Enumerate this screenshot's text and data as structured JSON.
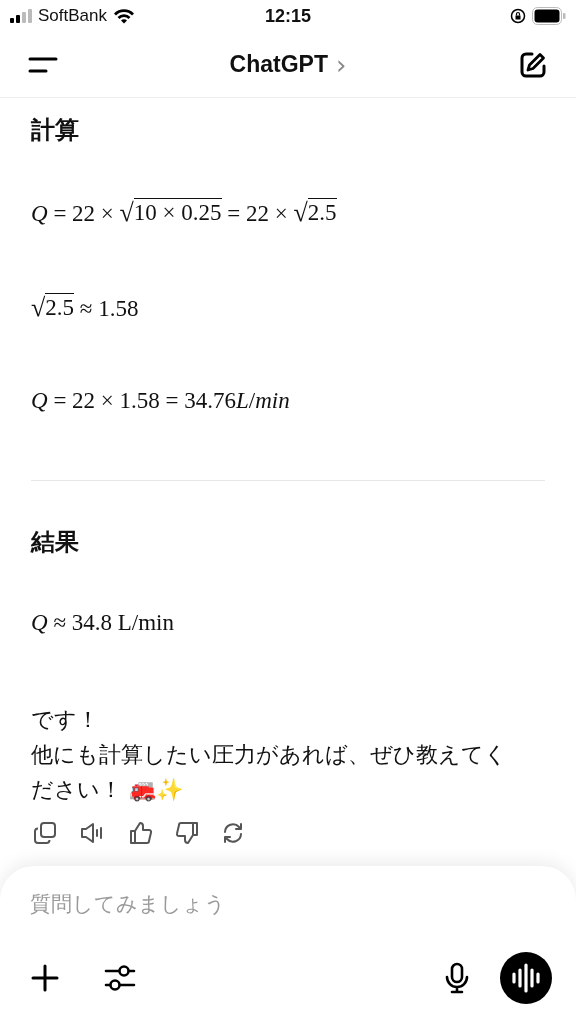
{
  "status_bar": {
    "carrier": "SoftBank",
    "time": "12:15"
  },
  "header": {
    "title": "ChatGPT",
    "chevron": "›"
  },
  "sections": [
    {
      "heading": "計算",
      "formulas": [
        [
          {
            "kind": "text",
            "text": "*Q* = 22 × "
          },
          {
            "kind": "sqrt",
            "radical": "√",
            "text": "10 × 0.25"
          },
          {
            "kind": "text",
            "text": " = 22 × "
          },
          {
            "kind": "sqrt",
            "radical": "√",
            "text": "2.5"
          }
        ],
        [
          {
            "kind": "sqrt",
            "radical": "√",
            "text": "2.5"
          },
          {
            "kind": "text",
            "text": " ≈ 1.58"
          }
        ],
        [
          {
            "kind": "text",
            "text": "*Q* = 22 × 1.58 = 34.76"
          },
          {
            "kind": "italic",
            "text": "L"
          },
          {
            "kind": "text",
            "text": "/"
          },
          {
            "kind": "italic",
            "text": "min"
          }
        ]
      ]
    },
    {
      "heading": "結果",
      "formulas": [
        [
          {
            "kind": "text",
            "text": "*Q* ≈ 34.8 L/min"
          }
        ]
      ]
    }
  ],
  "closing": [
    "です！",
    "他にも計算したい圧力があれば、ぜひ教えてください！ 🚒✨"
  ],
  "composer": {
    "placeholder": "質問してみましょう"
  }
}
